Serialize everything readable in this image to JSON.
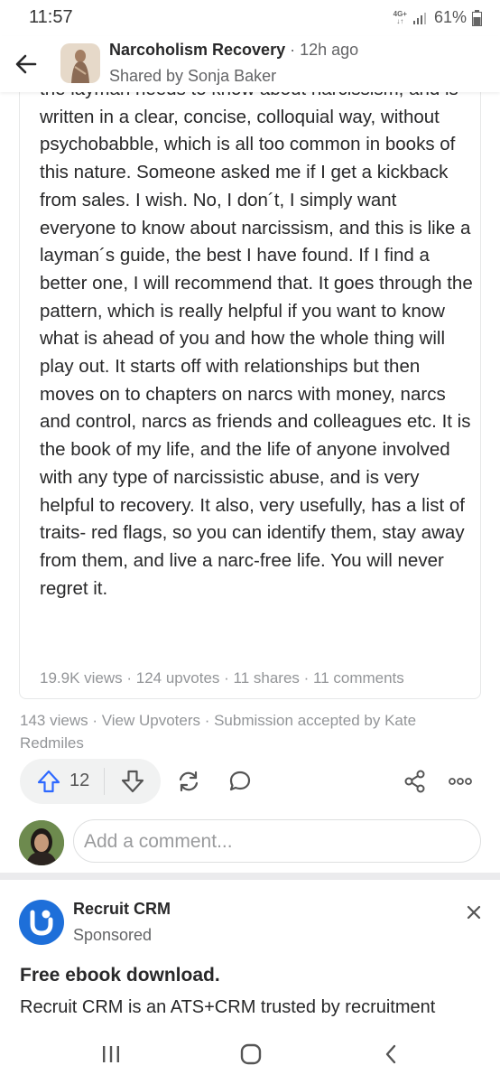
{
  "status": {
    "time": "11:57",
    "network": "4G+",
    "battery": "61%"
  },
  "header": {
    "space_name": "Narcoholism Recovery",
    "separator": "·",
    "time_ago": "12h ago",
    "shared_by": "Shared by Sonja Baker"
  },
  "post": {
    "body": "the layman needs to know about narcissism, and is written in a clear, concise, colloquial way, without psychobabble, which is all too common in books of this nature. Someone asked me if I get a kickback from sales. I wish. No, I don´t, I simply want everyone to know about narcissism, and this is like a layman´s guide, the best I have found. If I find a better one, I will recommend that. It goes through the pattern, which is really helpful if you want to know what is ahead of you and how the whole thing will play out. It starts off with relationships but then moves on to chapters on narcs with money, narcs and control, narcs as friends and colleagues etc. It is the book of my life, and the life of anyone involved with any type of narcissistic abuse, and is very helpful to recovery. It also, very usefully, has a list of traits- red flags, so you can identify them, stay away from them, and live a narc-free life. You will never regret it.",
    "stats": "19.9K views · 124 upvotes · 11 shares · 11 comments"
  },
  "share_meta": "143 views · View Upvoters · Submission accepted by Kate Redmiles",
  "actions": {
    "upvote_count": "12"
  },
  "comment": {
    "placeholder": "Add a comment..."
  },
  "ad": {
    "advertiser": "Recruit CRM",
    "sponsored_label": "Sponsored",
    "title": "Free ebook download.",
    "description": "Recruit CRM is an ATS+CRM trusted by recruitment"
  },
  "colors": {
    "upvote_blue": "#2e69ff",
    "ad_logo_blue": "#1e6fd9",
    "text_primary": "#282829",
    "text_secondary": "#939598"
  },
  "icons": [
    "back-arrow-icon",
    "upvote-icon",
    "downvote-icon",
    "reshare-icon",
    "comment-icon",
    "share-icon",
    "more-icon",
    "close-icon",
    "nav-recents-icon",
    "nav-home-icon",
    "nav-back-icon"
  ]
}
